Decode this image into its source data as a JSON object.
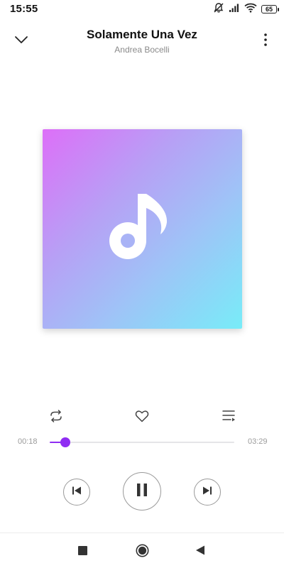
{
  "status_bar": {
    "time": "15:55",
    "battery": "65",
    "icons": [
      "notifications-off-icon",
      "signal-icon",
      "wifi-icon",
      "battery-icon"
    ]
  },
  "player": {
    "song_title": "Solamente Una Vez",
    "artist": "Andrea Bocelli",
    "elapsed": "00:18",
    "duration": "03:29",
    "progress_fraction": 0.086,
    "is_playing": true,
    "accent_color": "#8f2df2"
  },
  "header": {
    "collapse_icon": "chevron-down-icon",
    "more_icon": "more-vertical-icon"
  },
  "album_art": {
    "icon": "music-note-icon",
    "gradient": [
      "#dd6ff8",
      "#78ecf8"
    ]
  },
  "actions": {
    "icons": [
      "repeat-icon",
      "heart-icon",
      "queue-icon"
    ]
  },
  "controls": {
    "icons": [
      "previous-icon",
      "pause-icon",
      "next-icon"
    ]
  },
  "nav_bar": {
    "icons": [
      "recent-apps-icon",
      "home-icon",
      "back-icon"
    ]
  }
}
